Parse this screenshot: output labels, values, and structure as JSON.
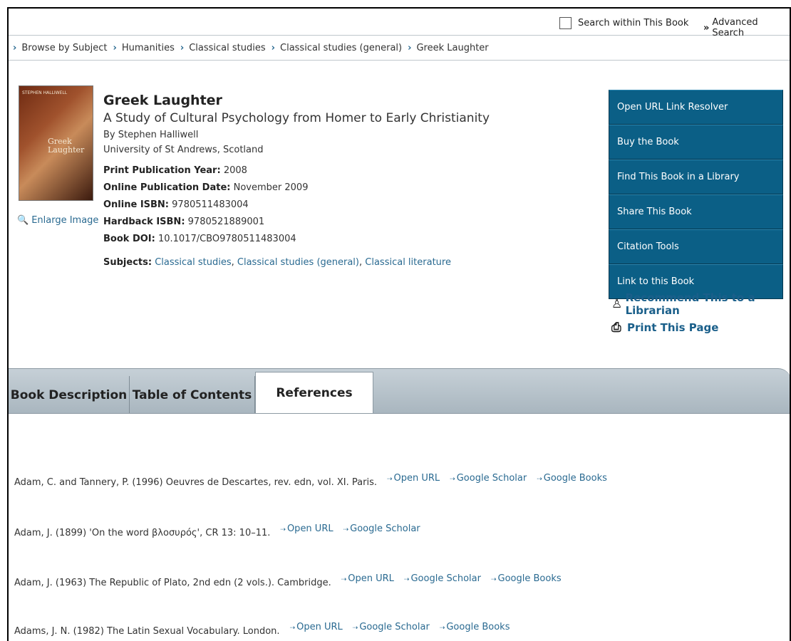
{
  "topbar": {
    "search_within_label": "Search within This Book",
    "advanced_search_label": "Advanced Search"
  },
  "breadcrumb": [
    "Browse by Subject",
    "Humanities",
    "Classical studies",
    "Classical studies (general)",
    "Greek Laughter"
  ],
  "book": {
    "title": "Greek Laughter",
    "subtitle": "A Study of Cultural Psychology from Homer to Early Christianity",
    "author": "By Stephen Halliwell",
    "affiliation": "University of St Andrews, Scotland",
    "cover_text": {
      "author_caps": "STEPHEN HALLIWELL",
      "title_line1": "Greek",
      "title_line2": "Laughter"
    },
    "enlarge_label": "Enlarge Image",
    "meta": [
      {
        "label": "Print Publication Year:",
        "value": "2008"
      },
      {
        "label": "Online Publication Date:",
        "value": "November 2009"
      },
      {
        "label": "Online ISBN:",
        "value": "9780511483004"
      },
      {
        "label": "Hardback ISBN:",
        "value": "9780521889001"
      },
      {
        "label": "Book DOI:",
        "value": "10.1017/CBO9780511483004"
      }
    ],
    "subjects_label": "Subjects:",
    "subjects": [
      "Classical studies",
      "Classical studies (general)",
      "Classical literature"
    ]
  },
  "actions": [
    "Open URL Link Resolver",
    "Buy the Book",
    "Find This Book in a Library",
    "Share This Book",
    "Citation Tools",
    "Link to this Book"
  ],
  "side_links": {
    "recommend": "Recommend This to a Librarian",
    "print": "Print This Page"
  },
  "tabs": [
    {
      "label": "Book Description",
      "active": false
    },
    {
      "label": "Table of Contents",
      "active": false
    },
    {
      "label": "References",
      "active": true
    }
  ],
  "references": [
    {
      "text": "Adam, C. and Tannery, P. (1996) Oeuvres de Descartes, rev. edn, vol. XI. Paris.",
      "links": [
        "Open URL",
        "Google Scholar",
        "Google Books"
      ]
    },
    {
      "text": "Adam, J. (1899) 'On the word βλοσυρός', CR 13: 10–11.",
      "links": [
        "Open URL",
        "Google Scholar"
      ]
    },
    {
      "text": "Adam, J. (1963) The Republic of Plato, 2nd edn (2 vols.). Cambridge.",
      "links": [
        "Open URL",
        "Google Scholar",
        "Google Books"
      ]
    },
    {
      "text": "Adams, J. N. (1982) The Latin Sexual Vocabulary. London.",
      "links": [
        "Open URL",
        "Google Scholar",
        "Google Books"
      ]
    }
  ],
  "colors": {
    "action_bg": "#0b5f86",
    "link": "#2a6a91",
    "tabs_bg": "#b5c1c9"
  }
}
